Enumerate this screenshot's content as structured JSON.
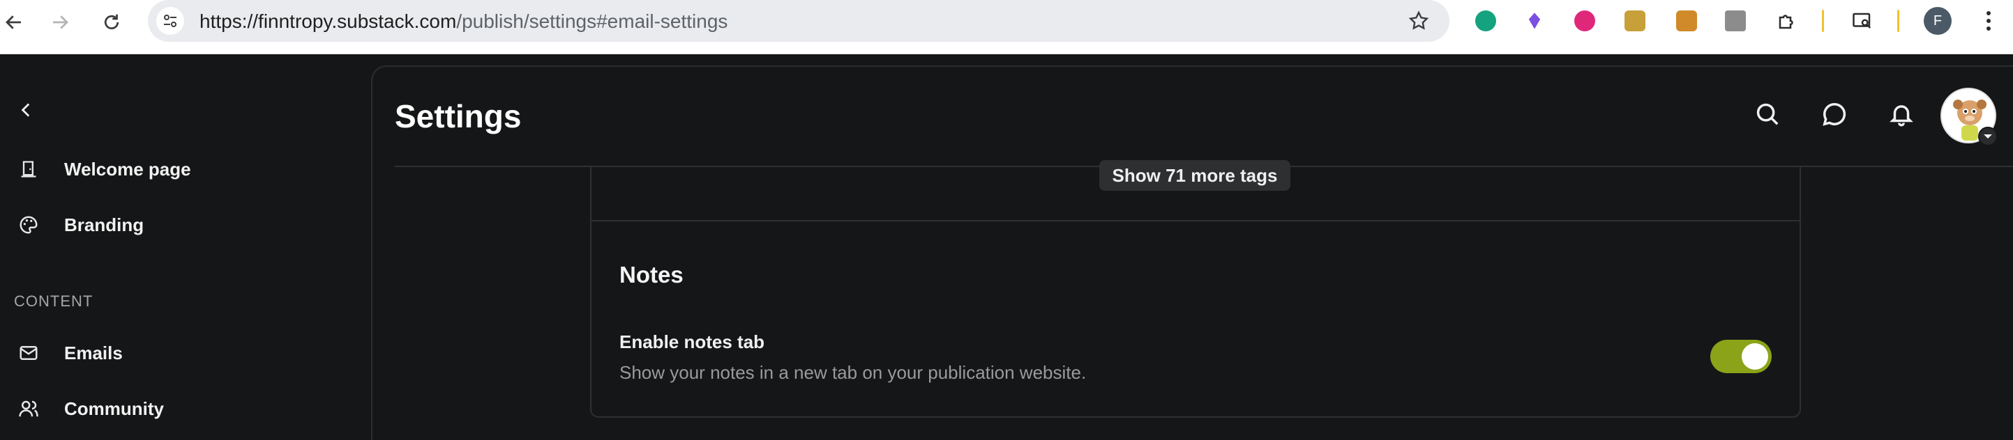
{
  "browser": {
    "url_host": "https://finntropy.substack.com",
    "url_path": "/publish/settings#email-settings",
    "profile_initial": "F",
    "extensions": [
      "grammarly-icon",
      "crystal-icon",
      "pink-circle-icon",
      "cc-extension-icon",
      "pro-extension-icon",
      "docs-extension-icon",
      "puzzle-icon",
      "tab-search-icon"
    ]
  },
  "sidebar": {
    "items": [
      {
        "label": "Welcome page",
        "icon": "page-icon"
      },
      {
        "label": "Branding",
        "icon": "palette-icon"
      },
      {
        "label": "Emails",
        "icon": "mail-icon"
      },
      {
        "label": "Community",
        "icon": "people-icon"
      }
    ],
    "section_content": "CONTENT"
  },
  "header": {
    "title": "Settings"
  },
  "main": {
    "show_more_tags": "Show 71 more tags",
    "notes": {
      "heading": "Notes",
      "option_title": "Enable notes tab",
      "option_desc": "Show your notes in a new tab on your publication website.",
      "enabled": true
    }
  },
  "colors": {
    "background": "#151617",
    "toggle_on": "#8aa319"
  }
}
